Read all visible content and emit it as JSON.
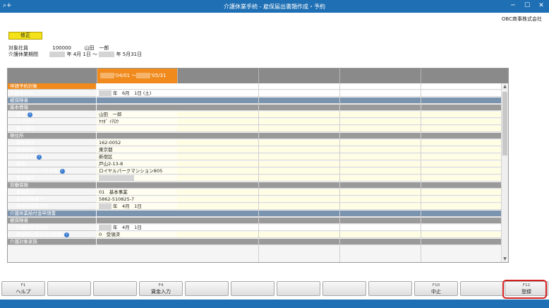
{
  "window": {
    "title": "介護休業手続 - 雇保届出書類作成・予約",
    "app_icon": "⌕+",
    "minimize": "─",
    "maximize": "☐",
    "close": "✕"
  },
  "company": "OBC商事株式会社",
  "mode_badge": "修正",
  "employee": {
    "label": "対象社員",
    "code": "100000",
    "name": "山田　一郎"
  },
  "period": {
    "label": "介護休業期間",
    "start": "年 4月 1日 ～",
    "end": "年 5月31日"
  },
  "grid": {
    "active_period": "'04/01 ～",
    "active_period_end": "'05/31"
  },
  "rows": [
    {
      "label": "申請予約対象",
      "value": "",
      "style": "sel"
    },
    {
      "label": "申請予約日",
      "value": "年　6月　1日 (土)",
      "style": "plain",
      "gray_prefix": true
    },
    {
      "label": "被保険者",
      "value": "",
      "style": "sec"
    },
    {
      "label": "基本情報",
      "value": "",
      "style": "sub"
    },
    {
      "label": "氏名",
      "value": "山田　一郎",
      "style": "data",
      "info": true
    },
    {
      "label": "フリガナ",
      "value": "ﾔﾏﾀﾞ ｲﾁﾛｳ",
      "style": "data"
    },
    {
      "label": "個人番号",
      "value": "",
      "style": "data"
    },
    {
      "label": "現住所",
      "value": "",
      "style": "sub"
    },
    {
      "label": "郵便番号",
      "value": "162-0052",
      "style": "data"
    },
    {
      "label": "都道府県",
      "value": "東京都",
      "style": "data"
    },
    {
      "label": "市区町村",
      "value": "新宿区",
      "style": "data",
      "info": true
    },
    {
      "label": "番地",
      "value": "戸山2-13-8",
      "style": "data"
    },
    {
      "label": "マンション／ビル等",
      "value": "ロイヤルパークマンション805",
      "style": "data",
      "info": true
    },
    {
      "label": "電話番号",
      "value": "",
      "style": "data",
      "gray_value": true
    },
    {
      "label": "労働保険",
      "value": "",
      "style": "sub"
    },
    {
      "label": "事業区分",
      "value": "01　基本事業",
      "style": "data"
    },
    {
      "label": "雇用保険番号",
      "value": "5862-510825-7",
      "style": "data"
    },
    {
      "label": "資格取得年月日",
      "value": "年　4月　1日",
      "style": "data",
      "gray_prefix": true
    },
    {
      "label": "介護休業給付金申請書",
      "value": "",
      "style": "sec"
    },
    {
      "label": "被保険者",
      "value": "",
      "style": "sub"
    },
    {
      "label": "介護休業開始日",
      "value": "年　4月　1日",
      "style": "plain",
      "gray_prefix": true
    },
    {
      "label": "申請等に関する同意書",
      "value": "0　受領済",
      "style": "data",
      "info": true
    },
    {
      "label": "介護対象家族",
      "value": "",
      "style": "sub"
    }
  ],
  "info_icon": "i",
  "function_keys": [
    {
      "num": "F1",
      "label": "ヘルプ"
    },
    {
      "num": "",
      "label": ""
    },
    {
      "num": "",
      "label": ""
    },
    {
      "num": "F4",
      "label": "賃金入力"
    },
    {
      "num": "",
      "label": ""
    },
    {
      "num": "",
      "label": ""
    },
    {
      "num": "",
      "label": ""
    },
    {
      "num": "",
      "label": ""
    },
    {
      "num": "",
      "label": ""
    },
    {
      "num": "F10",
      "label": "中止"
    },
    {
      "num": "",
      "label": ""
    },
    {
      "num": "F12",
      "label": "登録"
    }
  ]
}
